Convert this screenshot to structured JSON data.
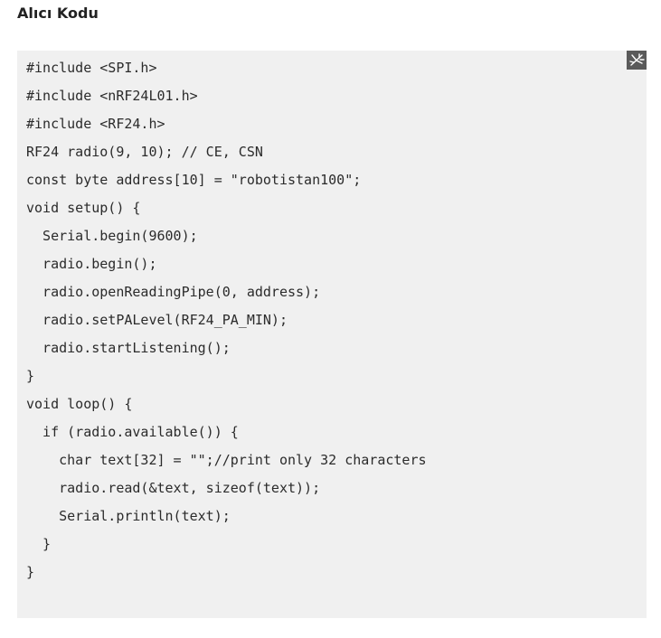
{
  "section": {
    "title": "Alıcı Kodu"
  },
  "code": {
    "toolbar": {
      "expand_icon": "expand-icon"
    },
    "lines": [
      "#include <SPI.h>",
      "#include <nRF24L01.h>",
      "#include <RF24.h>",
      "RF24 radio(9, 10); // CE, CSN",
      "const byte address[10] = \"robotistan100\";",
      "void setup() {",
      "  Serial.begin(9600);",
      "  radio.begin();",
      "  radio.openReadingPipe(0, address);",
      "  radio.setPALevel(RF24_PA_MIN);",
      "  radio.startListening();",
      "}",
      "void loop() {",
      "  if (radio.available()) {",
      "    char text[32] = \"\";//print only 32 characters",
      "    radio.read(&text, sizeof(text));",
      "    Serial.println(text);",
      "  }",
      "}"
    ]
  }
}
